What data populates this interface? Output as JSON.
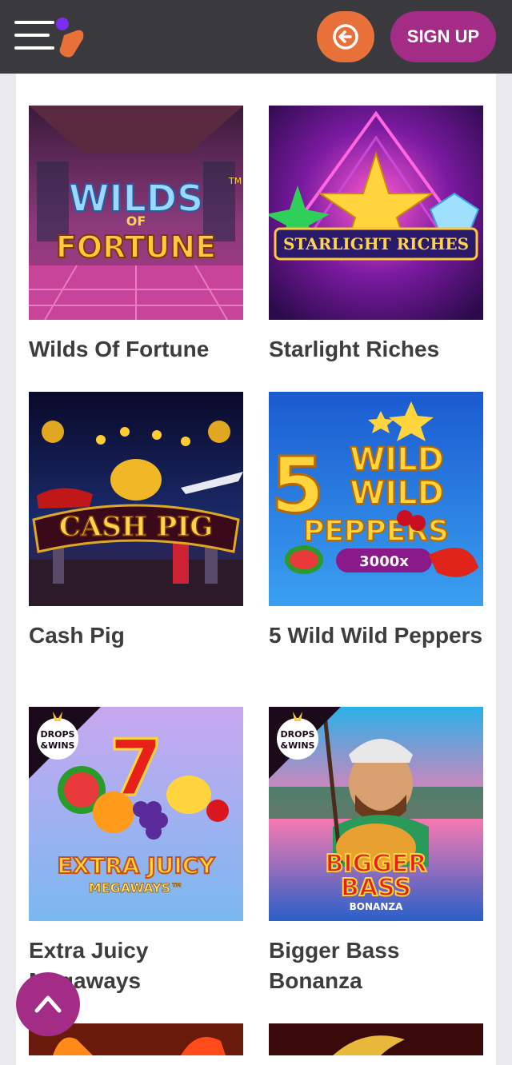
{
  "header": {
    "signup_label": "SIGN UP",
    "brand_colors": {
      "accent": "#e8713a",
      "primary": "#a22c86",
      "purple": "#7a2ff0"
    }
  },
  "games": [
    {
      "title": "Wilds Of Fortune",
      "logo_line1": "WILDS",
      "logo_line2": "OF",
      "logo_line3": "FORTUNE",
      "tm": "TM"
    },
    {
      "title": "Starlight Riches",
      "logo_line1": "STARLIGHT RICHES"
    },
    {
      "title": "Cash Pig",
      "logo_line1": "CASH PIG"
    },
    {
      "title": "5 Wild Wild Peppers",
      "logo_line1": "5",
      "logo_line2": "WILD",
      "logo_line3": "WILD",
      "logo_line4": "PEPPERS",
      "multiplier": "3000x"
    },
    {
      "title": "Extra Juicy Megaways",
      "logo_line1": "EXTRA JUICY",
      "logo_line2": "MEGAWAYS™",
      "badge_line1": "DROPS",
      "badge_line2": "&WINS"
    },
    {
      "title": "Bigger Bass Bonanza",
      "logo_line1": "BIGGER",
      "logo_line2": "BASS",
      "logo_line3": "BONANZA",
      "badge_line1": "DROPS",
      "badge_line2": "&WINS"
    }
  ]
}
